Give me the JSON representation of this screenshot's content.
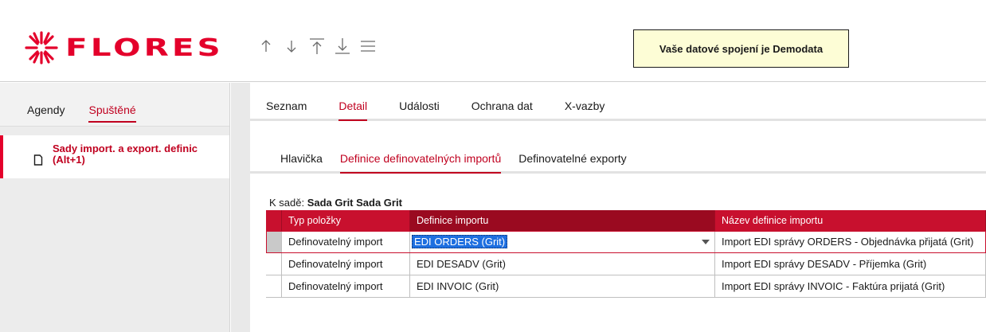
{
  "brand": {
    "name": "FLORES",
    "accent": "#e4002b"
  },
  "toolbar": {
    "icons": [
      "arrow-up-icon",
      "arrow-down-icon",
      "arrow-to-top-icon",
      "arrow-to-bottom-icon",
      "menu-icon"
    ]
  },
  "connection": {
    "label": "Vaše datové spojení je Demodata"
  },
  "left": {
    "tabs": [
      {
        "label": "Agendy",
        "active": false
      },
      {
        "label": "Spuštěné",
        "active": true
      }
    ],
    "items": [
      {
        "label": "Sady import. a export. definic (Alt+1)"
      }
    ]
  },
  "main": {
    "tabs": [
      {
        "label": "Seznam"
      },
      {
        "label": "Detail",
        "active": true
      },
      {
        "label": "Události"
      },
      {
        "label": "Ochrana dat"
      },
      {
        "label": "X-vazby"
      }
    ],
    "subtabs": [
      {
        "label": "Hlavička"
      },
      {
        "label": "Definice definovatelných importů",
        "active": true
      },
      {
        "label": "Definovatelné exporty"
      }
    ],
    "set": {
      "prefix": "K sadě:",
      "value": "Sada Grit Sada Grit"
    }
  },
  "grid": {
    "columns": [
      "Typ položky",
      "Definice importu",
      "Název definice importu"
    ],
    "rows": [
      [
        "Definovatelný import",
        "EDI ORDERS (Grit)",
        "Import EDI správy ORDERS - Objednávka přijatá (Grit)"
      ],
      [
        "Definovatelný import",
        "EDI DESADV (Grit)",
        "Import EDI správy DESADV - Příjemka (Grit)"
      ],
      [
        "Definovatelný import",
        "EDI INVOIC (Grit)",
        "Import EDI správy INVOIC - Faktúra prijatá (Grit)"
      ]
    ]
  }
}
